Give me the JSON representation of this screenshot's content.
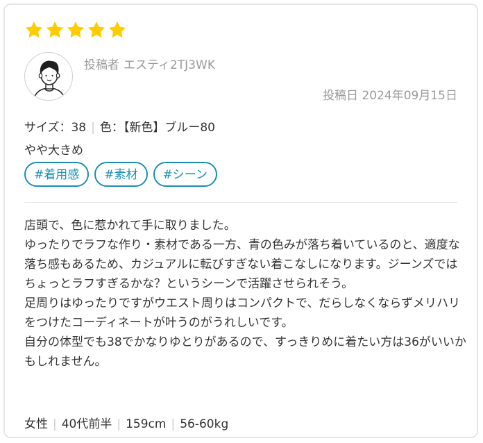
{
  "rating": {
    "stars": 5,
    "max": 5,
    "star_color": "#ffcc00"
  },
  "poster": {
    "label": "投稿者",
    "name": "エスティ2TJ3WK",
    "avatar": "avatar-icon"
  },
  "post_date": "投稿日 2024年09月15日",
  "purchase": {
    "size_label": "サイズ：38",
    "color_label": "色：【新色】ブルー80"
  },
  "fit": "やや大きめ",
  "tags": [
    "#着用感",
    "#素材",
    "#シーン"
  ],
  "body": [
    "店頭で、色に惹かれて手に取りました。",
    "ゆったりでラフな作り・素材である一方、青の色みが落ち着いているのと、適度な落ち感もあるため、カジュアルに転びすぎない着こなしになります。ジーンズではちょっとラフすぎるかな？というシーンで活躍させられそう。",
    "足周りはゆったりですがウエスト周りはコンパクトで、だらしなくならずメリハリをつけたコーディネートが叶うのがうれしいです。",
    "自分の体型でも38でかなりゆとりがあるので、すっきりめに着たい方は36がいいかもしれません。"
  ],
  "reviewer_profile": {
    "gender": "女性",
    "age": "40代前半",
    "height": "159cm",
    "weight": "56-60kg"
  },
  "colors": {
    "accent": "#1a8fb5",
    "muted_text": "#9a9a9a",
    "border": "#e6e6e6"
  }
}
